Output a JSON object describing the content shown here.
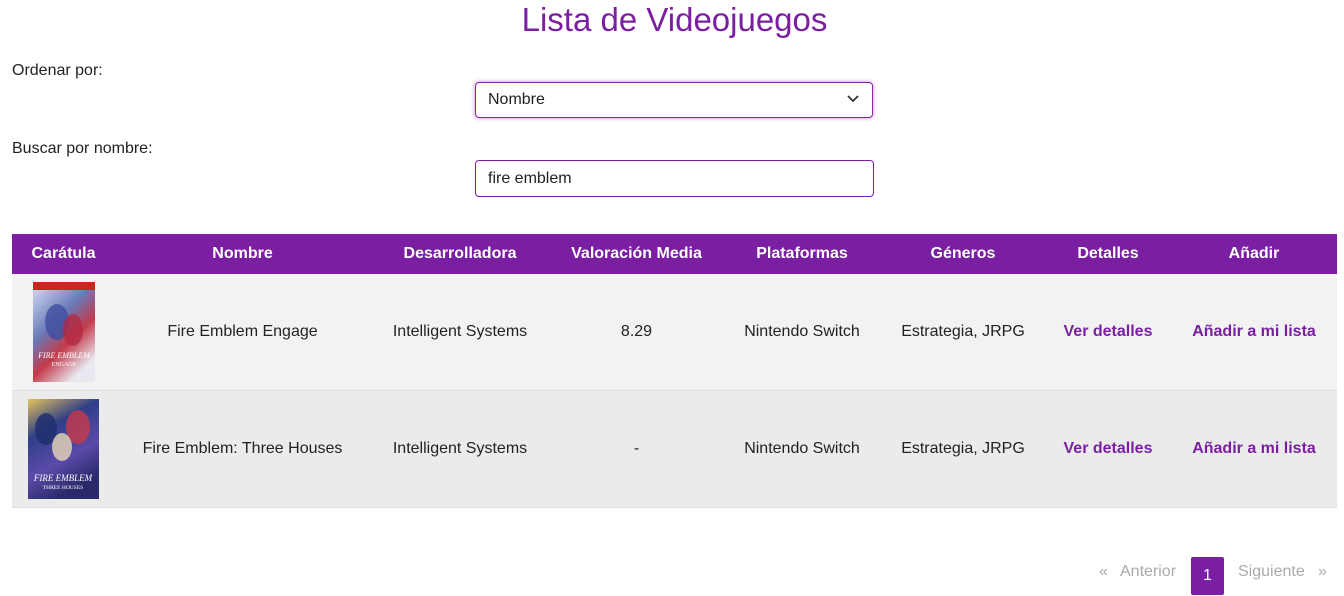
{
  "page": {
    "title": "Lista de Videojuegos"
  },
  "sort": {
    "label": "Ordenar por:",
    "selected": "Nombre"
  },
  "search": {
    "label": "Buscar por nombre:",
    "value": "fire emblem"
  },
  "table": {
    "headers": [
      "Carátula",
      "Nombre",
      "Desarrolladora",
      "Valoración Media",
      "Plataformas",
      "Géneros",
      "Detalles",
      "Añadir"
    ],
    "rows": [
      {
        "name": "Fire Emblem Engage",
        "developer": "Intelligent Systems",
        "rating": "8.29",
        "platforms": "Nintendo Switch",
        "genres": "Estrategia, JRPG",
        "details": "Ver detalles",
        "add": "Añadir a mi lista",
        "cover_text": "FIRE EMBLEM ENGAGE"
      },
      {
        "name": "Fire Emblem: Three Houses",
        "developer": "Intelligent Systems",
        "rating": "-",
        "platforms": "Nintendo Switch",
        "genres": "Estrategia, JRPG",
        "details": "Ver detalles",
        "add": "Añadir a mi lista",
        "cover_text": "FIRE EMBLEM THREE HOUSES"
      }
    ]
  },
  "pagination": {
    "prev_icon": "«",
    "prev": "Anterior",
    "current": "1",
    "next": "Siguiente",
    "next_icon": "»"
  },
  "colors": {
    "accent": "#7b1fa2"
  }
}
